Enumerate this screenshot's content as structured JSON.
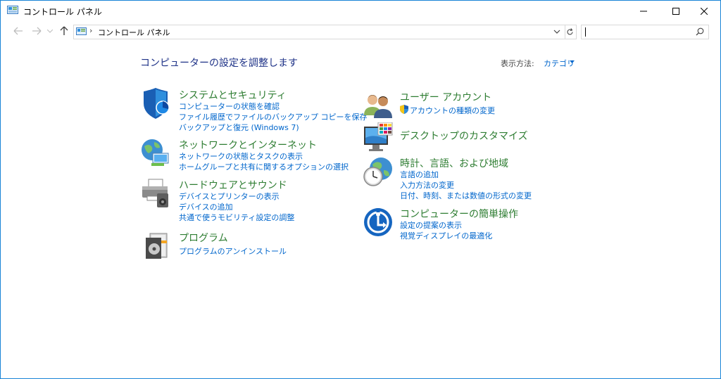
{
  "window": {
    "title": "コントロール パネル"
  },
  "addressbar": {
    "crumb": "コントロール パネル",
    "search_placeholder": ""
  },
  "main": {
    "heading": "コンピューターの設定を調整します",
    "view_by_label": "表示方法:",
    "view_by_value": "カテゴリ",
    "left": [
      {
        "title": "システムとセキュリティ",
        "icon": "shield-icon",
        "links": [
          "コンピューターの状態を確認",
          "ファイル履歴でファイルのバックアップ コピーを保存",
          "バックアップと復元 (Windows 7)"
        ]
      },
      {
        "title": "ネットワークとインターネット",
        "icon": "network-globe-icon",
        "links": [
          "ネットワークの状態とタスクの表示",
          "ホームグループと共有に関するオプションの選択"
        ]
      },
      {
        "title": "ハードウェアとサウンド",
        "icon": "printer-speaker-icon",
        "links": [
          "デバイスとプリンターの表示",
          "デバイスの追加",
          "共通で使うモビリティ設定の調整"
        ]
      },
      {
        "title": "プログラム",
        "icon": "programs-disc-icon",
        "links": [
          "プログラムのアンインストール"
        ]
      }
    ],
    "right": [
      {
        "title": "ユーザー アカウント",
        "icon": "users-icon",
        "links": [
          "アカウントの種類の変更"
        ]
      },
      {
        "title": "デスクトップのカスタマイズ",
        "icon": "monitor-palette-icon",
        "links": []
      },
      {
        "title": "時計、言語、および地域",
        "icon": "clock-globe-icon",
        "links": [
          "言語の追加",
          "入力方法の変更",
          "日付、時刻、または数値の形式の変更"
        ]
      },
      {
        "title": "コンピューターの簡単操作",
        "icon": "ease-of-access-icon",
        "links": [
          "設定の提案の表示",
          "視覚ディスプレイの最適化"
        ]
      }
    ]
  },
  "colors": {
    "category_title": "#2e7d32",
    "link": "#0066cc",
    "heading": "#1e3287",
    "window_border": "#1883d7"
  }
}
